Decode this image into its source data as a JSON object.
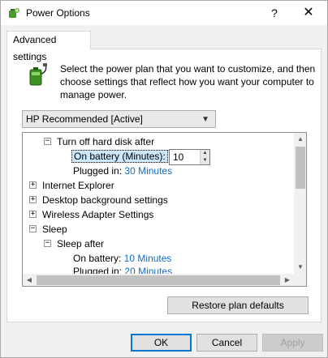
{
  "window": {
    "title": "Power Options",
    "help_glyph": "?",
    "close_glyph": "✕"
  },
  "tabs": [
    {
      "label": "Advanced settings",
      "active": true
    }
  ],
  "description": "Select the power plan that you want to customize, and then choose settings that reflect how you want your computer to manage power.",
  "plan_select": {
    "value": "HP Recommended [Active]"
  },
  "tree": {
    "rows": [
      {
        "label": "Turn off hard disk after",
        "expander": "−",
        "expanded": true
      },
      {
        "label": "On battery (Minutes):",
        "selected": true,
        "spin_value": "10"
      },
      {
        "label": "Plugged in:",
        "value": "30 Minutes"
      },
      {
        "label": "Internet Explorer",
        "expander": "+",
        "expanded": false
      },
      {
        "label": "Desktop background settings",
        "expander": "+",
        "expanded": false
      },
      {
        "label": "Wireless Adapter Settings",
        "expander": "+",
        "expanded": false
      },
      {
        "label": "Sleep",
        "expander": "−",
        "expanded": true
      },
      {
        "label": "Sleep after",
        "expander": "−",
        "expanded": true
      },
      {
        "label": "On battery:",
        "value": "10 Minutes"
      },
      {
        "label": "Plugged in:",
        "value": "20 Minutes"
      }
    ]
  },
  "buttons": {
    "restore": "Restore plan defaults",
    "ok": "OK",
    "cancel": "Cancel",
    "apply": "Apply"
  },
  "colors": {
    "link": "#1a6bbd",
    "selection": "#cce8ff",
    "focus": "#0078d7"
  }
}
